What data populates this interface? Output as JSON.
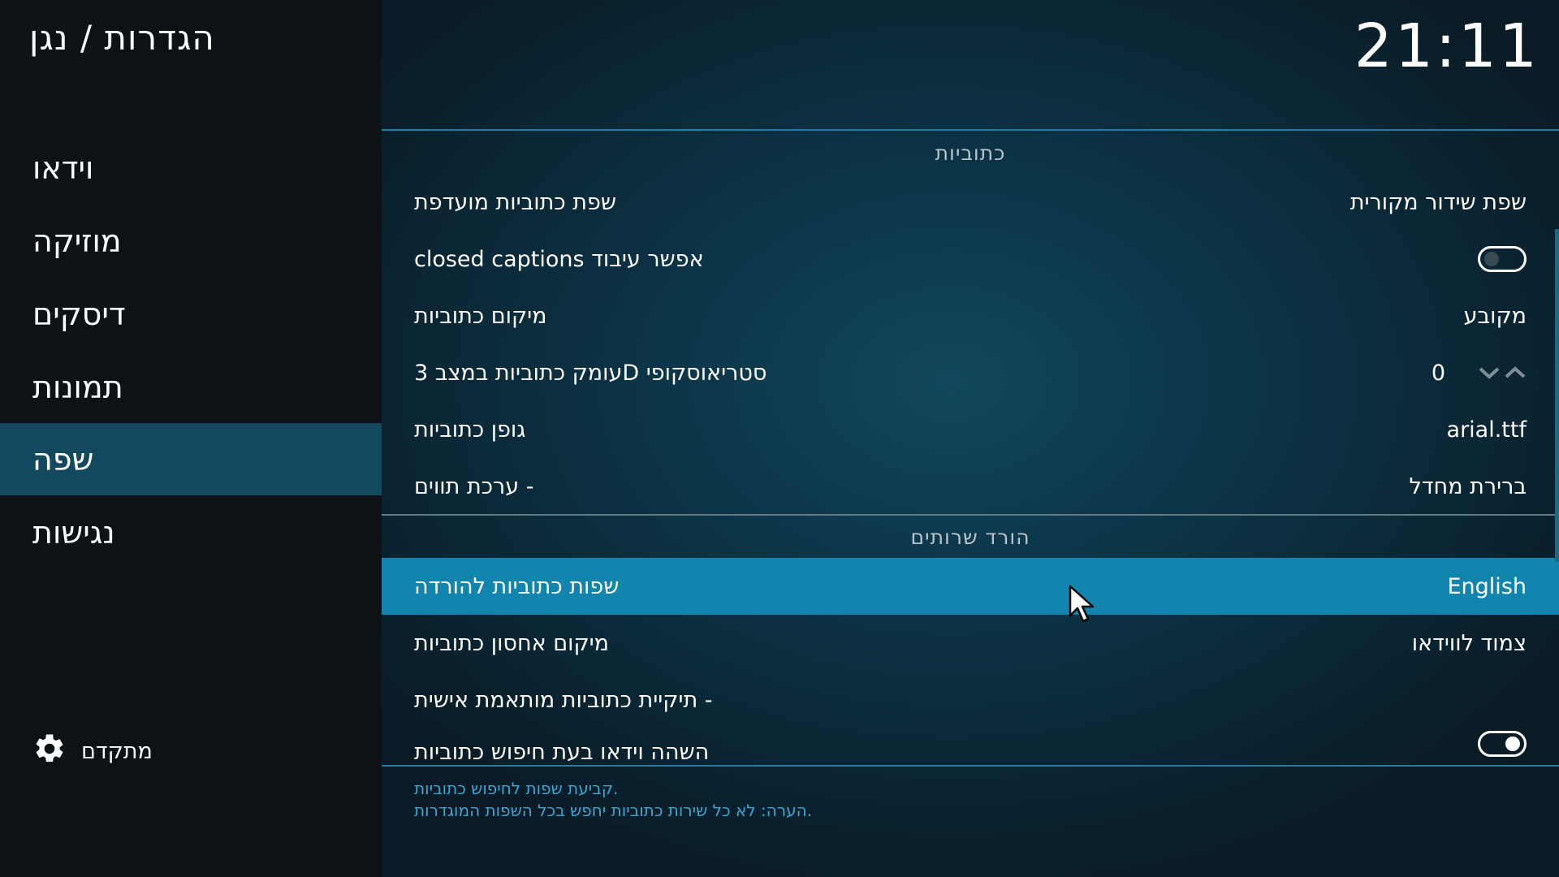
{
  "header": {
    "title": "הגדרות / נגן",
    "clock": "21:11"
  },
  "sidebar": {
    "items": [
      {
        "label": "וידאו",
        "active": false
      },
      {
        "label": "מוזיקה",
        "active": false
      },
      {
        "label": "דיסקים",
        "active": false
      },
      {
        "label": "תמונות",
        "active": false
      },
      {
        "label": "שפה",
        "active": true
      },
      {
        "label": "נגישות",
        "active": false
      }
    ],
    "advanced_label": "מתקדם"
  },
  "sections": {
    "subtitles": {
      "title": "כתוביות",
      "rows": [
        {
          "label": "שפת כתוביות מועדפת",
          "value": "שפת שידור מקורית"
        },
        {
          "label": "closed captions אפשר עיבוד",
          "toggle": "off"
        },
        {
          "label": "מיקום כתוביות",
          "value": "מקובע"
        },
        {
          "label": "עומק כתוביות במצב 3D סטריאוסקופי",
          "value": "0"
        },
        {
          "label": "גופן כתוביות",
          "value": "arial.ttf"
        },
        {
          "label": "ערכת תווים -",
          "value": "ברירת מחדל"
        }
      ]
    },
    "download_services": {
      "title": "הורד שרותים",
      "rows": [
        {
          "label": "שפות כתוביות להורדה",
          "value": "English",
          "selected": true
        },
        {
          "label": "מיקום אחסון כתוביות",
          "value": "צמוד לווידאו"
        },
        {
          "label": "תיקיית כתוביות מותאמת אישית -",
          "value": ""
        },
        {
          "label": "השהה וידאו בעת חיפוש כתוביות",
          "toggle": "on"
        }
      ]
    }
  },
  "help": {
    "line1": "קביעת שפות לחיפוש כתוביות.",
    "line2": "הערה: לא כל שירות כתוביות יחפש בכל השפות המוגדרות."
  },
  "colors": {
    "accent": "#1185ae",
    "sidebar_active": "#12495f",
    "help_text": "#3aa6d3"
  }
}
